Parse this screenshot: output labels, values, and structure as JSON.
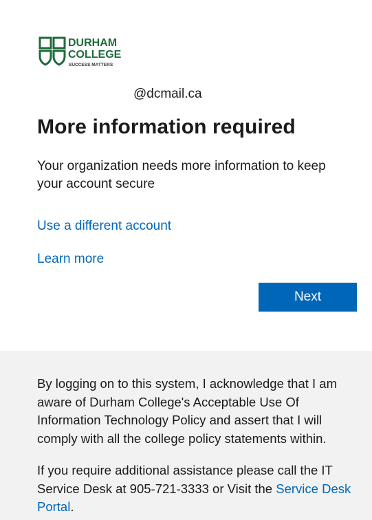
{
  "logo": {
    "line1": "DURHAM",
    "line2": "COLLEGE",
    "tagline": "SUCCESS MATTERS",
    "color": "#1e6b3a"
  },
  "account": {
    "username": "@dcmail.ca"
  },
  "main": {
    "title": "More information required",
    "description": "Your organization needs more information to keep your account secure",
    "use_different_account": "Use a different account",
    "learn_more": "Learn more",
    "next_label": "Next"
  },
  "footer": {
    "notice": "By logging on to this system, I acknowledge that I am aware of Durham College's Acceptable Use Of Information Technology Policy and assert that I will comply with all the college policy statements within.",
    "help_prefix": "If you require additional assistance please call the IT Service Desk at 905-721-3333 or Visit the ",
    "help_link": "Service Desk Portal",
    "help_suffix": "."
  },
  "colors": {
    "accent": "#0067b8",
    "footer_bg": "#f2f2f2",
    "text": "#1b1b1b"
  }
}
